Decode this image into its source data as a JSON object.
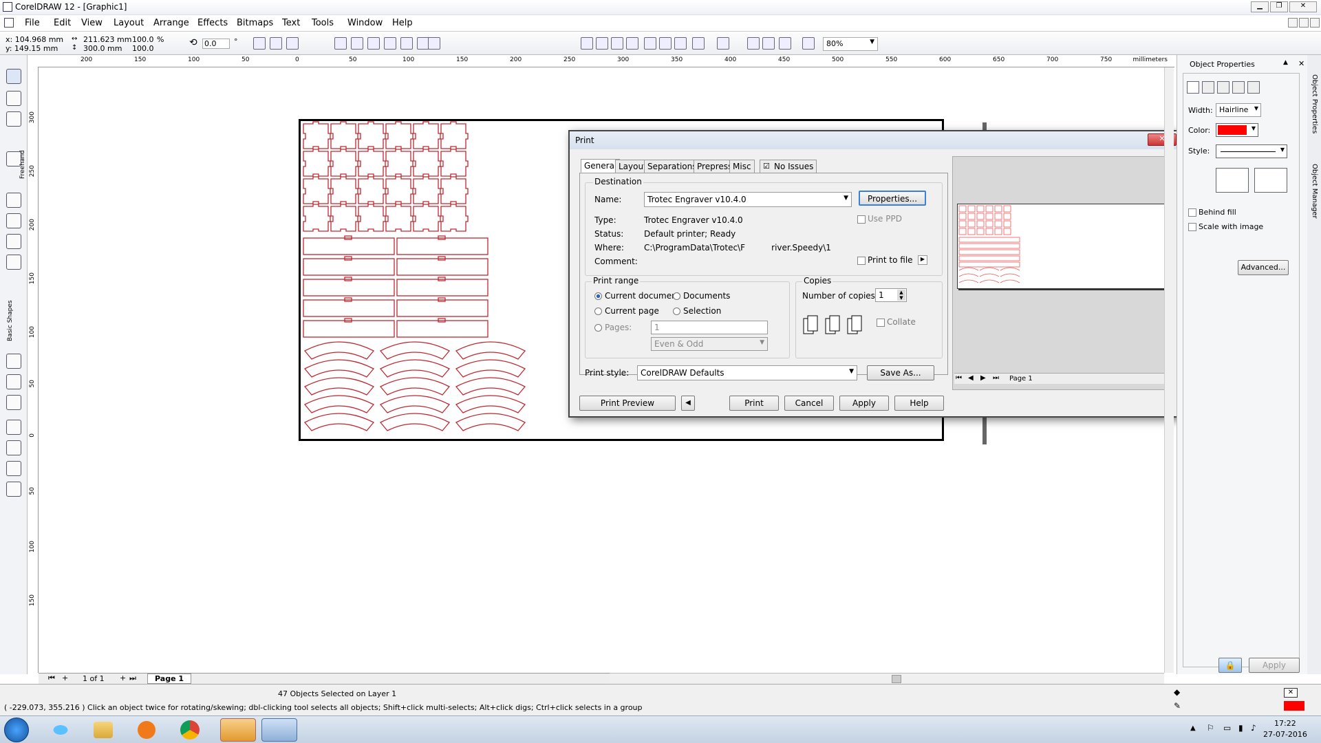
{
  "app": {
    "title": "CorelDRAW 12 - [Graphic1]"
  },
  "menu": [
    "File",
    "Edit",
    "View",
    "Layout",
    "Arrange",
    "Effects",
    "Bitmaps",
    "Text",
    "Tools",
    "Window",
    "Help"
  ],
  "propbar": {
    "x": "x: 104.968 mm",
    "y": "y: 149.15 mm",
    "w": "211.623 mm",
    "h": "300.0 mm",
    "sx": "100.0",
    "sy": "100.0",
    "pct": "%",
    "angle": "0.0",
    "deg": "°",
    "zoom": "80%"
  },
  "ruler": {
    "h_ticks": [
      "200",
      "150",
      "100",
      "50",
      "0",
      "50",
      "100",
      "150",
      "200",
      "250",
      "300",
      "350",
      "400",
      "450",
      "500",
      "550",
      "600",
      "650",
      "700",
      "750"
    ],
    "unit": "millimeters",
    "v_ticks": [
      "300",
      "250",
      "200",
      "150",
      "100",
      "50",
      "0",
      "50",
      "100",
      "150"
    ]
  },
  "toolbox": {
    "freehand": "Freehand",
    "basic_shapes": "Basic Shapes"
  },
  "print_dialog": {
    "title": "Print",
    "tabs": [
      "General",
      "Layout",
      "Separations",
      "Prepress",
      "Misc",
      "No Issues"
    ],
    "destination": {
      "group": "Destination",
      "name_label": "Name:",
      "name_value": "Trotec Engraver v10.4.0",
      "properties_btn": "Properties...",
      "type_label": "Type:",
      "type_value": "Trotec Engraver v10.4.0",
      "status_label": "Status:",
      "status_value": "Default printer; Ready",
      "where_label": "Where:",
      "where_value": "C:\\ProgramData\\Trotec\\F          river.Speedy\\1",
      "comment_label": "Comment:",
      "use_ppd": "Use PPD",
      "print_to_file": "Print to file"
    },
    "print_range": {
      "group": "Print range",
      "current_document": "Current document",
      "documents": "Documents",
      "current_page": "Current page",
      "selection": "Selection",
      "pages": "Pages:",
      "pages_value": "1",
      "even_odd": "Even & Odd"
    },
    "copies": {
      "group": "Copies",
      "number_label": "Number of copies:",
      "number_value": "1",
      "collate": "Collate"
    },
    "print_style_label": "Print style:",
    "print_style_value": "CorelDRAW Defaults",
    "save_as": "Save As...",
    "buttons": {
      "preview": "Print Preview",
      "print": "Print",
      "cancel": "Cancel",
      "apply": "Apply",
      "help": "Help"
    },
    "preview_page": "Page 1"
  },
  "object_properties": {
    "title": "Object Properties",
    "width_label": "Width:",
    "width_value": "Hairline",
    "color_label": "Color:",
    "color_value": "#ff0000",
    "style_label": "Style:",
    "behind_fill": "Behind fill",
    "scale_with_image": "Scale with image",
    "advanced": "Advanced...",
    "apply": "Apply",
    "vtab1": "Object Properties",
    "vtab2": "Object Manager"
  },
  "page_nav": {
    "count": "1 of 1",
    "page": "Page 1"
  },
  "status": {
    "selection": "47 Objects Selected on Layer 1",
    "hint": "( -229.073, 355.216 )   Click an object twice for rotating/skewing; dbl-clicking tool selects all objects; Shift+click multi-selects; Alt+click digs; Ctrl+click selects in a group"
  },
  "taskbar": {
    "time": "17:22",
    "date": "27-07-2016"
  },
  "colors": {
    "accent_red": "#c0262e",
    "selection_blue": "#3399ff"
  }
}
